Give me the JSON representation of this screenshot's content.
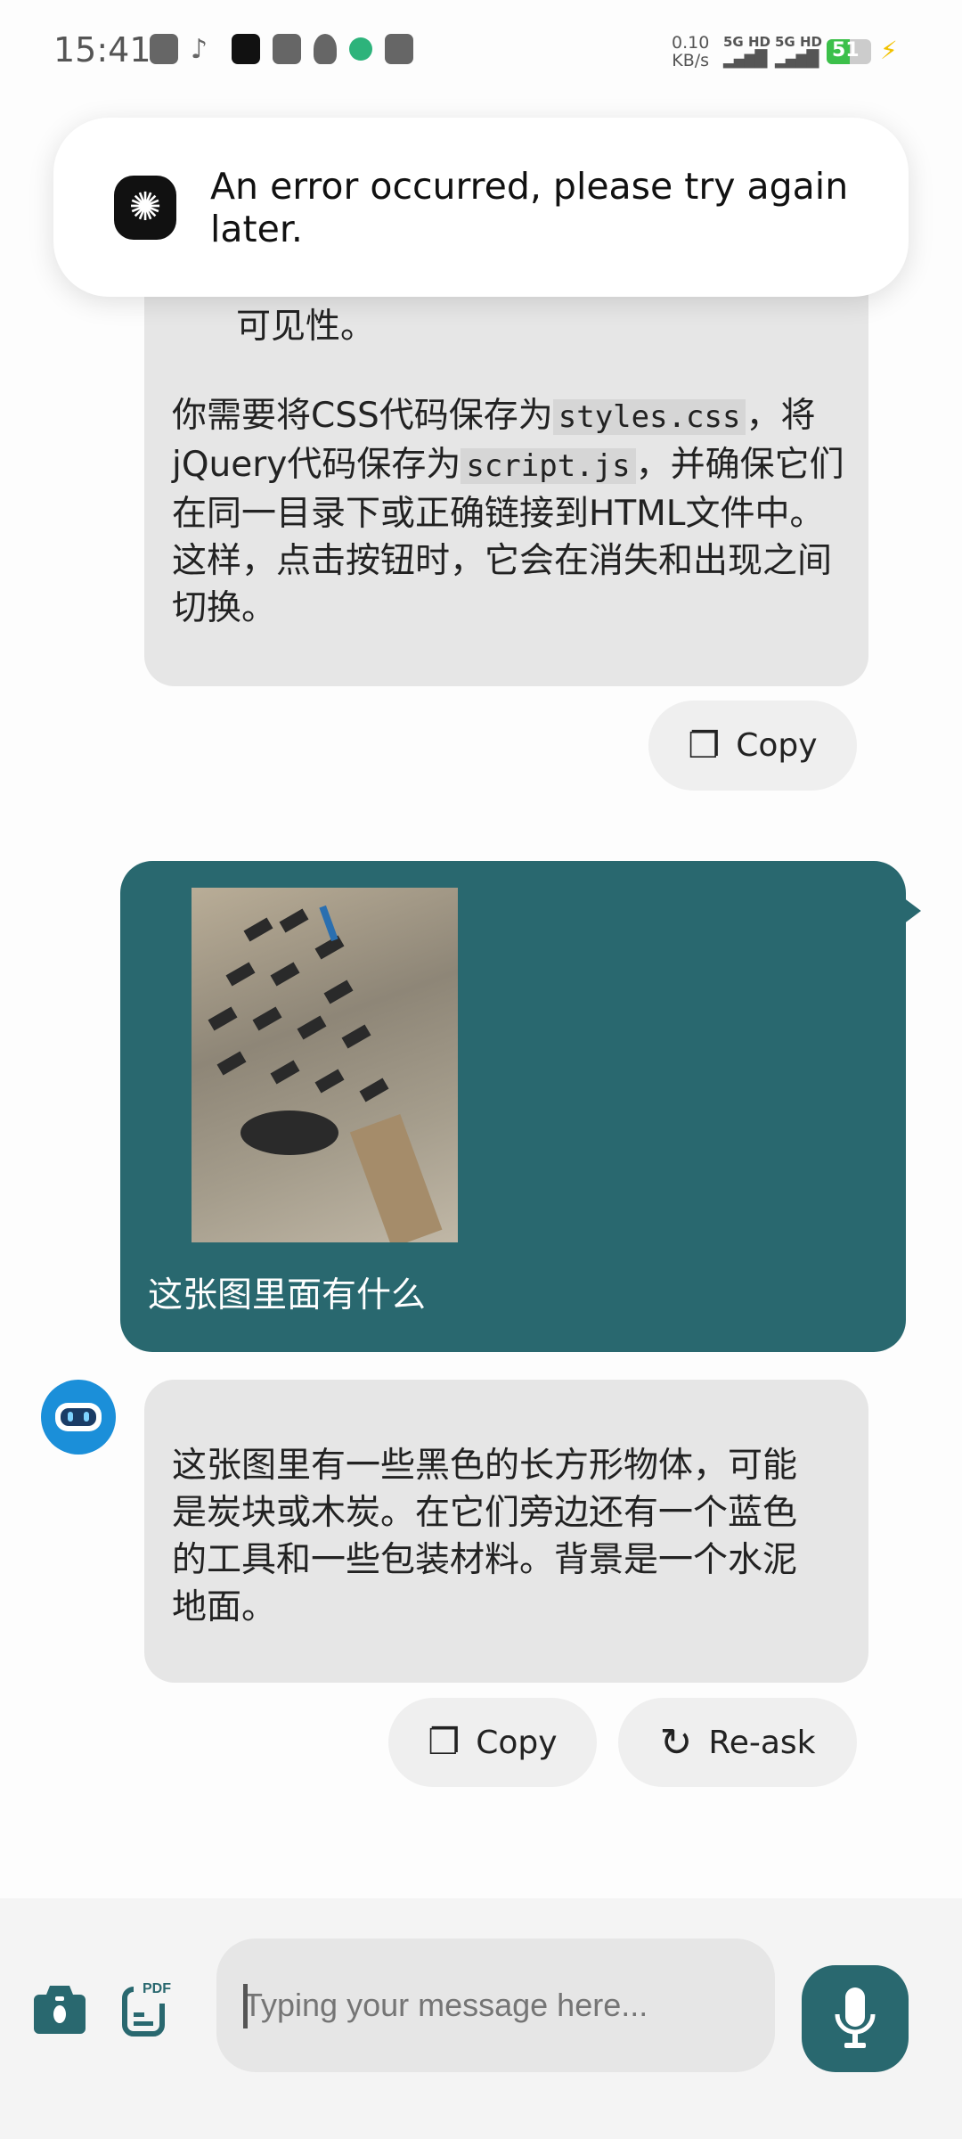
{
  "status_bar": {
    "time": "15:41",
    "net_speed": "0.10",
    "net_unit": "KB/s",
    "sim1": "5G HD",
    "sim2": "5G HD",
    "battery": "51",
    "battery_level": 51
  },
  "toast": {
    "message": "An error occurred, please try again later."
  },
  "messages": {
    "assistant1": {
      "partial_line": "可见性。",
      "p_before1": "你需要将CSS代码保存为",
      "code1": "styles.css",
      "p_mid": "，将jQuery代码保存为",
      "code2": "script.js",
      "p_after": "，并确保它们在同一目录下或正确链接到HTML文件中。这样，点击按钮时，它会在消失和出现之间切换。",
      "copy_label": "Copy"
    },
    "user1": {
      "text": "这张图里面有什么"
    },
    "assistant2": {
      "text": "这张图里有一些黑色的长方形物体，可能是炭块或木炭。在它们旁边还有一个蓝色的工具和一些包装材料。背景是一个水泥地面。",
      "copy_label": "Copy",
      "reask_label": "Re-ask"
    }
  },
  "composer": {
    "placeholder": "Typing your message here...",
    "pdf_label": "PDF"
  },
  "colors": {
    "accent": "#29686f",
    "bubble": "#e6e6e6",
    "avatar": "#1b8fd9"
  }
}
